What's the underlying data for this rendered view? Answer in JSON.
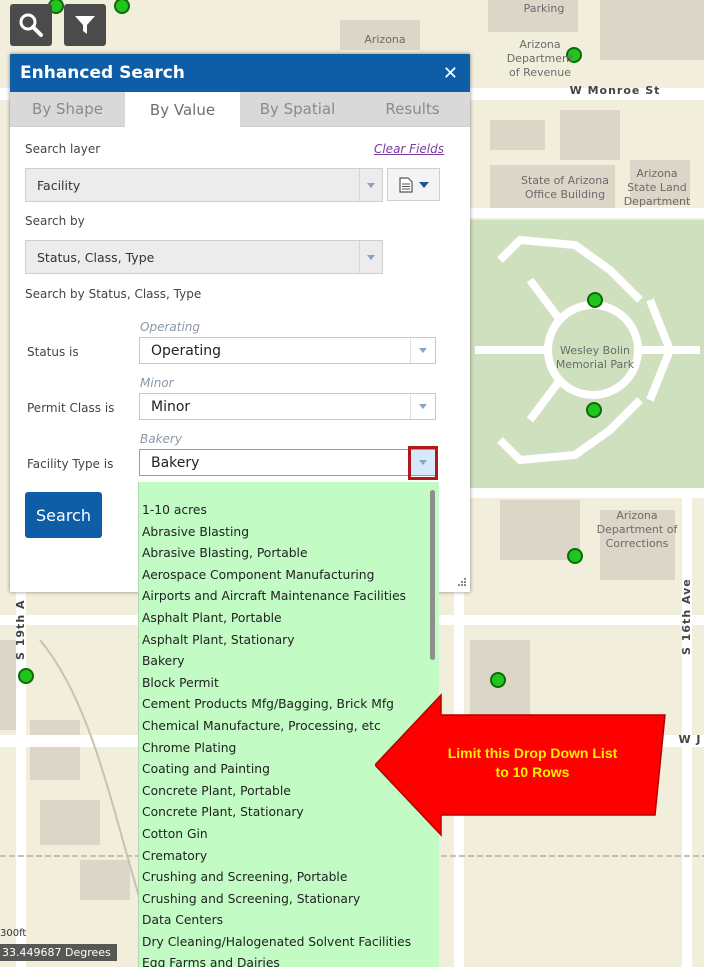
{
  "map": {
    "labels": {
      "parking": "Parking",
      "az_top": "Arizona",
      "dept_revenue": "Arizona\nDepartment\nof Revenue",
      "monroe": "W Monroe St",
      "state_office": "State of Arizona\nOffice Building",
      "state_land": "Arizona\nState Land\nDepartment",
      "wesley": "Wesley Bolin\nMemorial Park",
      "corrections": "Arizona\nDepartment of\nCorrections",
      "s16th": "S 16th Ave",
      "s19th": "S 19th A",
      "wj": "W J"
    },
    "scale_text": "300ft",
    "coordinate_readout": "33.449687 Degrees"
  },
  "tools": {
    "search_icon": "search-icon",
    "filter_icon": "filter-icon"
  },
  "panel": {
    "title": "Enhanced Search",
    "close_glyph": "✕",
    "tabs": [
      {
        "label": "By Shape",
        "active": false
      },
      {
        "label": "By Value",
        "active": true
      },
      {
        "label": "By Spatial",
        "active": false
      },
      {
        "label": "Results",
        "active": false
      }
    ],
    "search_layer_label": "Search layer",
    "clear_fields": "Clear Fields",
    "search_layer_value": "Facility",
    "search_by_label": "Search by",
    "search_by_value": "Status, Class, Type",
    "search_by_summary": "Search by Status, Class, Type",
    "status": {
      "label": "Status is",
      "hint": "Operating",
      "value": "Operating"
    },
    "permit_class": {
      "label": "Permit Class is",
      "hint": "Minor",
      "value": "Minor"
    },
    "facility_type": {
      "label": "Facility Type is",
      "hint": "Bakery",
      "value": "Bakery"
    },
    "search_button": "Search"
  },
  "dropdown": {
    "options": [
      "1-10 acres",
      "Abrasive Blasting",
      "Abrasive Blasting, Portable",
      "Aerospace Component Manufacturing",
      "Airports and Aircraft Maintenance Facilities",
      "Asphalt Plant, Portable",
      "Asphalt Plant, Stationary",
      "Bakery",
      "Block Permit",
      "Cement Products Mfg/Bagging, Brick Mfg",
      "Chemical Manufacture, Processing, etc",
      "Chrome Plating",
      "Coating and Painting",
      "Concrete Plant, Portable",
      "Concrete Plant, Stationary",
      "Cotton Gin",
      "Crematory",
      "Crushing and Screening, Portable",
      "Crushing and Screening, Stationary",
      "Data Centers",
      "Dry Cleaning/Halogenated Solvent Facilities",
      "Egg Farms and Dairies"
    ]
  },
  "callout": {
    "line1": "Limit this Drop Down List",
    "line2": "to 10 Rows",
    "fill_color": "#ff0000"
  }
}
